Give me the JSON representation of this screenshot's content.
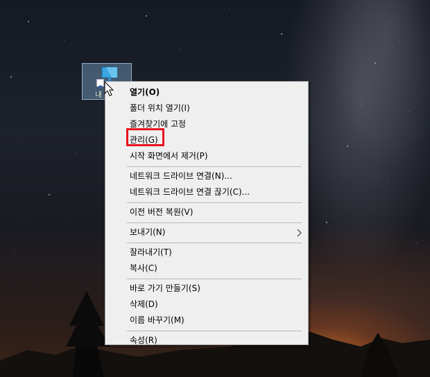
{
  "desktop": {
    "icon": {
      "label": "내"
    }
  },
  "context_menu": {
    "groups": [
      [
        {
          "label": "열기(O)",
          "bold": true
        },
        {
          "label": "폴더 위치 열기(I)"
        },
        {
          "label": "즐겨찾기에 고정"
        },
        {
          "label": "관리(G)",
          "highlighted": true
        },
        {
          "label": "시작 화면에서 제거(P)"
        }
      ],
      [
        {
          "label": "네트워크 드라이브 연결(N)..."
        },
        {
          "label": "네트워크 드라이브 연결 끊기(C)..."
        }
      ],
      [
        {
          "label": "이전 버전 복원(V)"
        }
      ],
      [
        {
          "label": "보내기(N)",
          "submenu": true
        }
      ],
      [
        {
          "label": "잘라내기(T)"
        },
        {
          "label": "복사(C)"
        }
      ],
      [
        {
          "label": "바로 가기 만들기(S)"
        },
        {
          "label": "삭제(D)"
        },
        {
          "label": "이름 바꾸기(M)"
        }
      ],
      [
        {
          "label": "속성(R)"
        }
      ]
    ]
  },
  "colors": {
    "menu_background": "#efefef",
    "separator": "#b9b9b9",
    "highlight_border": "#e8141e"
  },
  "icons": [
    "monitor-icon",
    "shortcut-arrow-icon",
    "mouse-cursor-icon",
    "chevron-right-icon"
  ]
}
